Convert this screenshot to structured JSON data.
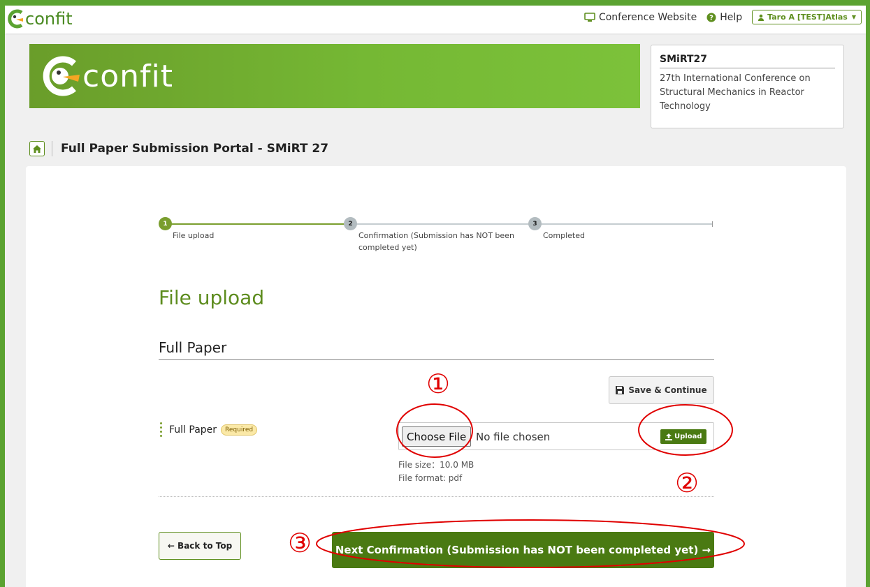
{
  "topnav": {
    "logo_text": "confit",
    "conference_website_label": "Conference Website",
    "help_label": "Help",
    "user_label": "Taro A [TEST]Atlas"
  },
  "banner": {
    "logo_text": "confit"
  },
  "conference": {
    "abbr": "SMiRT27",
    "full_name": "27th International Conference on Structural Mechanics in Reactor Technology"
  },
  "portal": {
    "title": "Full Paper Submission Portal - SMiRT 27"
  },
  "stepper": {
    "steps": [
      {
        "number": "1",
        "label": "File upload"
      },
      {
        "number": "2",
        "label": "Confirmation (Submission has NOT been completed yet)"
      },
      {
        "number": "3",
        "label": "Completed"
      }
    ]
  },
  "form": {
    "heading": "File upload",
    "section_heading": "Full Paper",
    "save_label": "Save & Continue",
    "field_label": "Full Paper",
    "required_badge": "Required",
    "choose_file_label": "Choose File",
    "no_file_text": "No file chosen",
    "upload_label": "Upload",
    "file_size_text": "File size：10.0 MB",
    "file_format_text": "File format: pdf"
  },
  "actions": {
    "back_label": "← Back to Top",
    "next_label": "Next Confirmation (Submission has NOT been completed yet) →"
  },
  "annotations": {
    "one": "①",
    "two": "②",
    "three": "③"
  },
  "colors": {
    "accent": "#4a7a12",
    "brand_green": "#5ba331",
    "annotation_red": "#e00000"
  }
}
